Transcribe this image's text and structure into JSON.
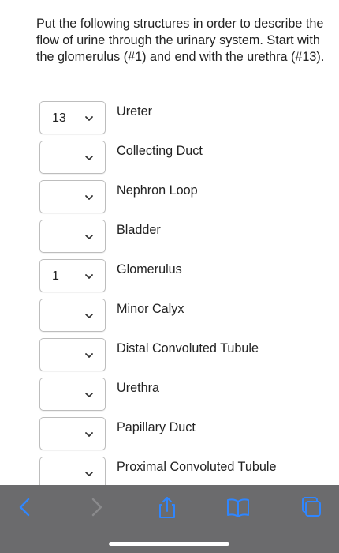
{
  "question": {
    "text": "Put the following structures in order to describe the flow of urine through the urinary system. Start with the glomerulus (#1) and end with the urethra (#13)."
  },
  "items": [
    {
      "selected": "13",
      "label": "Ureter"
    },
    {
      "selected": "",
      "label": "Collecting Duct"
    },
    {
      "selected": "",
      "label": "Nephron Loop"
    },
    {
      "selected": "",
      "label": "Bladder"
    },
    {
      "selected": "1",
      "label": "Glomerulus"
    },
    {
      "selected": "",
      "label": "Minor Calyx"
    },
    {
      "selected": "",
      "label": "Distal Convoluted Tubule"
    },
    {
      "selected": "",
      "label": "Urethra"
    },
    {
      "selected": "",
      "label": "Papillary Duct"
    },
    {
      "selected": "",
      "label": "Proximal Convoluted Tubule"
    }
  ],
  "toolbar": {
    "icons": [
      "back-chevron-icon",
      "forward-chevron-icon",
      "share-icon",
      "bookmarks-book-icon",
      "tabs-icon"
    ],
    "background": "#6b6b6d",
    "active_icon_color": "#2f86ff",
    "disabled_icon_color": "#8a8a8c"
  }
}
